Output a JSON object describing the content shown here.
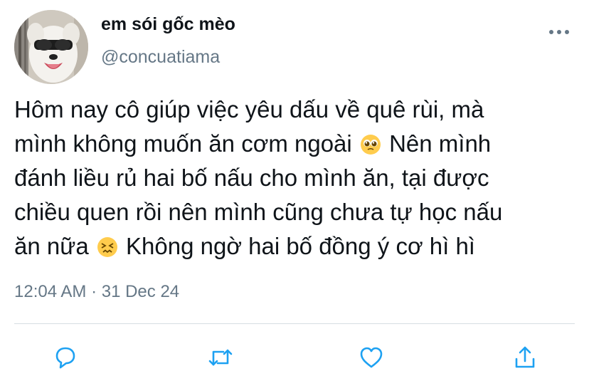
{
  "user": {
    "display_name": "em sói gốc mèo",
    "handle": "@concuatiama",
    "avatar": "dog-with-sunglasses-avatar"
  },
  "tweet": {
    "lines": [
      {
        "text": "Hôm nay cô giúp việc yêu dấu về quê rùi, mà"
      },
      {
        "text": "mình không muốn ăn cơm ngoài",
        "emoji": "pleading-face",
        "after": "Nên mình"
      },
      {
        "text": "đánh liều rủ hai bố nấu cho mình ăn, tại được"
      },
      {
        "text": "chiều quen rồi nên mình cũng chưa tự học nấu"
      },
      {
        "text": "ăn nữa",
        "emoji": "confounded-face",
        "after": "Không ngờ hai bố đồng ý cơ hì hì"
      }
    ],
    "timestamp": "12:04 AM · 31 Dec 24"
  },
  "actions": [
    {
      "name": "reply",
      "icon": "reply-bubble-icon"
    },
    {
      "name": "retweet",
      "icon": "retweet-arrows-icon"
    },
    {
      "name": "like",
      "icon": "heart-icon"
    },
    {
      "name": "share",
      "icon": "share-arrow-icon"
    }
  ],
  "colors": {
    "text": "#0f1419",
    "secondary": "#657786",
    "divider": "#d6dde2",
    "icon": "#1da1f2"
  }
}
